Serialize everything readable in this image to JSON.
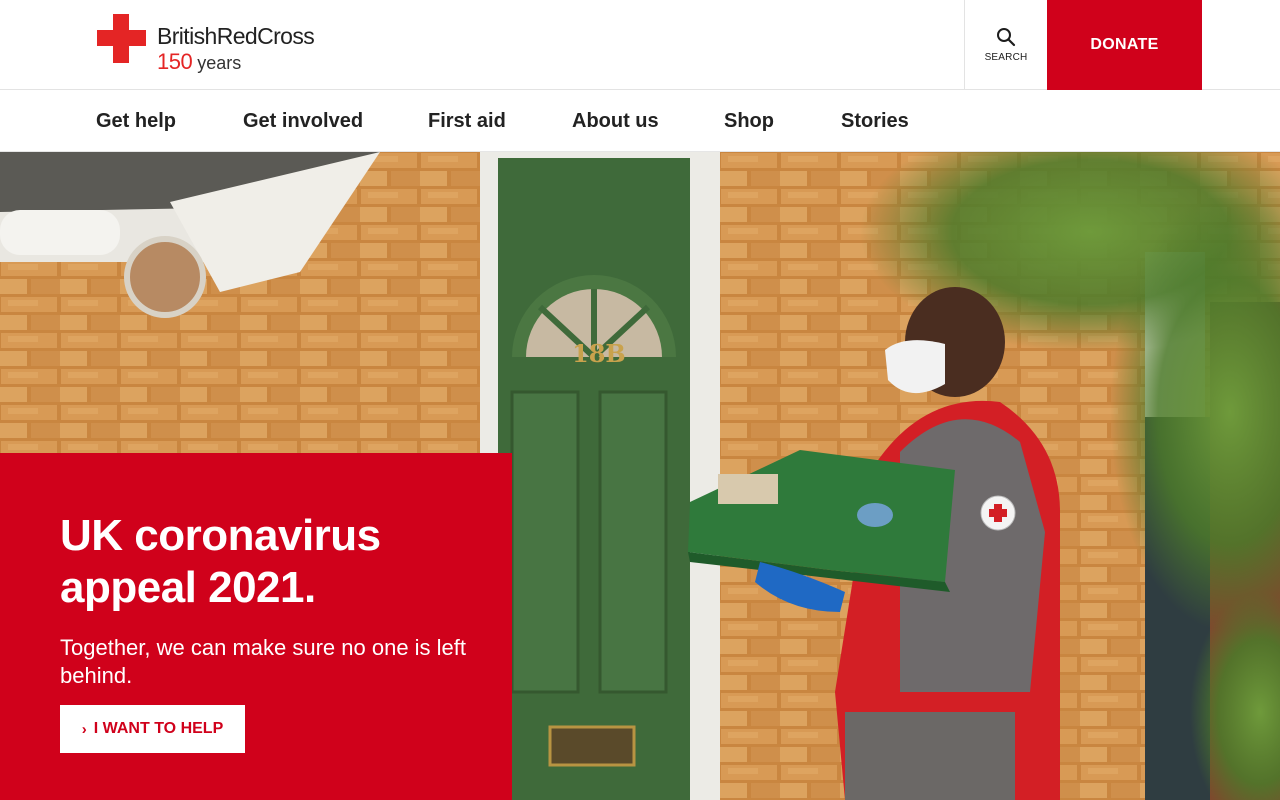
{
  "header": {
    "logo_name": "BritishRedCross",
    "logo_years_number": "150",
    "logo_years_word": "years",
    "search_label": "SEARCH",
    "donate_label": "DONATE"
  },
  "nav": {
    "items": [
      {
        "label": "Get help"
      },
      {
        "label": "Get involved"
      },
      {
        "label": "First aid"
      },
      {
        "label": "About us"
      },
      {
        "label": "Shop"
      },
      {
        "label": "Stories"
      }
    ]
  },
  "hero": {
    "title": "UK coronavirus appeal 2021.",
    "subtitle": "Together, we can make sure no one is left behind.",
    "cta_label": "I WANT TO HELP",
    "door_number": "18B"
  },
  "colors": {
    "brand_red": "#d0011b",
    "logo_red": "#e42525"
  },
  "icons": {
    "logo": "red-cross-icon",
    "search": "search-icon",
    "cta": "chevron-right-icon"
  }
}
